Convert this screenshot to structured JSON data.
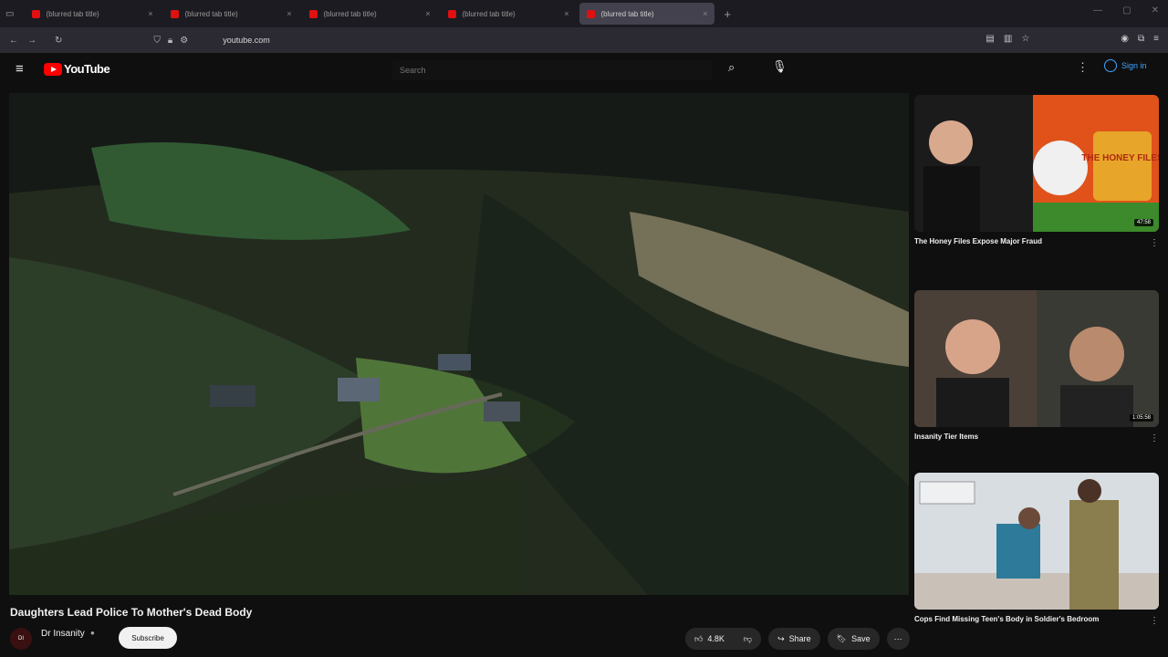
{
  "browser": {
    "tabs": [
      {
        "title": "(blurred tab title)"
      },
      {
        "title": "(blurred tab title)"
      },
      {
        "title": "(blurred tab title)"
      },
      {
        "title": "(blurred tab title)"
      },
      {
        "title": "(blurred tab title)",
        "active": true
      }
    ],
    "url": "youtube.com"
  },
  "youtube": {
    "logo_text": "YouTube",
    "search_placeholder": "Search",
    "sign_in_label": "Sign in"
  },
  "video": {
    "title": "Daughters Lead Police To Mother's Dead Body",
    "channel_avatar_text": "DI",
    "channel_name": "Dr Insanity",
    "subscribe_label": "Subscribe",
    "like_count": "4.8K",
    "share_label": "Share",
    "save_label": "Save"
  },
  "recommendations": [
    {
      "title": "The Honey Files Expose Major Fraud",
      "thumb_text": "THE HONEY FILES",
      "duration": "47:58"
    },
    {
      "title": "Insanity Tier Items",
      "duration": "1:05:58"
    },
    {
      "title": "Cops Find Missing Teen's Body in Soldier's Bedroom",
      "duration": ""
    }
  ],
  "colors": {
    "brand_red": "#ff0000",
    "link_blue": "#3ea6ff",
    "bg": "#0f0f0f"
  }
}
